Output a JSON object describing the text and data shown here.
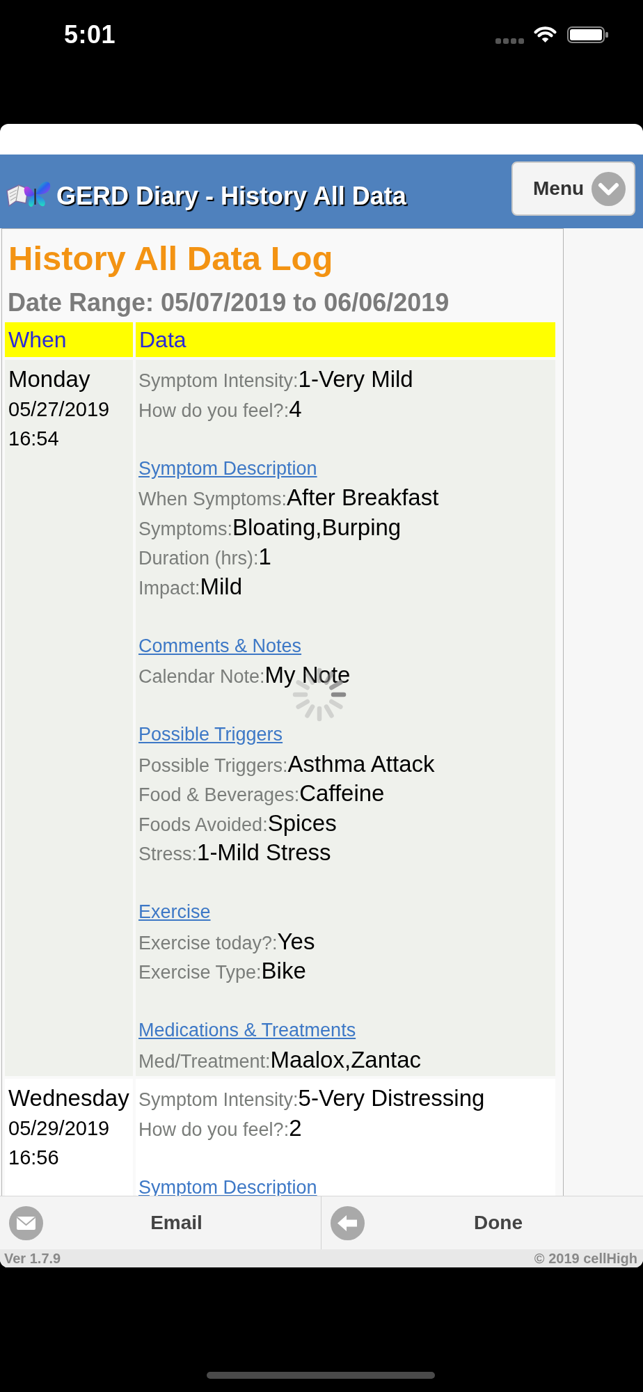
{
  "status_bar": {
    "time": "5:01"
  },
  "header": {
    "title": "GERD Diary - History All Data",
    "menu_button": "Menu"
  },
  "loading": true,
  "log": {
    "title": "History All Data Log",
    "date_range": "Date Range: 05/07/2019 to 06/06/2019",
    "columns": [
      "When",
      "Data"
    ],
    "rows": [
      {
        "day": "Monday",
        "date": "05/27/2019",
        "time": "16:54",
        "groups": [
          {
            "fields": [
              {
                "label": "Symptom Intensity:",
                "value": "1-Very Mild"
              },
              {
                "label": "How do you feel?:",
                "value": "4"
              }
            ]
          },
          {
            "heading": "Symptom Description",
            "fields": [
              {
                "label": "When Symptoms:",
                "value": "After Breakfast"
              },
              {
                "label": "Symptoms:",
                "value": "Bloating,Burping"
              },
              {
                "label": "Duration (hrs):",
                "value": "1"
              },
              {
                "label": "Impact:",
                "value": "Mild"
              }
            ]
          },
          {
            "heading": "Comments & Notes",
            "fields": [
              {
                "label": "Calendar Note:",
                "value": "My Note"
              }
            ]
          },
          {
            "heading": "Possible Triggers",
            "fields": [
              {
                "label": "Possible Triggers:",
                "value": "Asthma Attack"
              },
              {
                "label": "Food & Beverages:",
                "value": "Caffeine"
              },
              {
                "label": "Foods Avoided:",
                "value": "Spices"
              },
              {
                "label": "Stress:",
                "value": "1-Mild Stress"
              }
            ]
          },
          {
            "heading": "Exercise",
            "fields": [
              {
                "label": "Exercise today?:",
                "value": "Yes"
              },
              {
                "label": "Exercise Type:",
                "value": "Bike"
              }
            ]
          },
          {
            "heading": "Medications & Treatments",
            "fields": [
              {
                "label": "Med/Treatment:",
                "value": "Maalox,Zantac"
              }
            ]
          }
        ]
      },
      {
        "day": "Wednesday",
        "date": "05/29/2019",
        "time": "16:56",
        "groups": [
          {
            "fields": [
              {
                "label": "Symptom Intensity:",
                "value": "5-Very Distressing"
              },
              {
                "label": "How do you feel?:",
                "value": "2"
              }
            ]
          },
          {
            "heading": "Symptom Description"
          }
        ]
      }
    ]
  },
  "toolbar": [
    {
      "kind": "email",
      "label": "Email"
    },
    {
      "kind": "back",
      "label": "Done"
    }
  ],
  "footer": {
    "version": "Ver 1.7.9",
    "copyright": "© 2019 cellHigh"
  }
}
